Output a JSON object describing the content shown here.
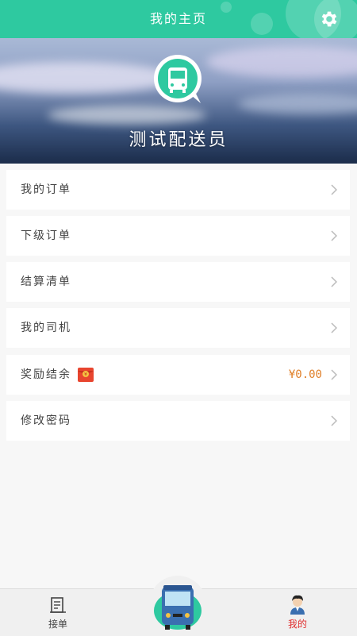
{
  "header": {
    "title": "我的主页",
    "settings_icon": "gear-icon"
  },
  "profile": {
    "name": "测试配送员",
    "logo_icon": "bus-chat-icon"
  },
  "menu": [
    {
      "label": "我的订单"
    },
    {
      "label": "下级订单"
    },
    {
      "label": "结算清单"
    },
    {
      "label": "我的司机"
    },
    {
      "label": "奖励结余",
      "amount": "¥0.00",
      "badge_icon": "red-envelope-icon"
    },
    {
      "label": "修改密码"
    }
  ],
  "bottom_nav": {
    "left": {
      "label": "接单",
      "icon": "receipt-icon"
    },
    "center": {
      "icon": "bus-icon"
    },
    "right": {
      "label": "我的",
      "icon": "user-avatar-icon",
      "active": true
    }
  },
  "colors": {
    "brand": "#2ec9a0",
    "amount": "#e0802a",
    "active_tab": "#e03030",
    "inactive_tab": "#444444"
  }
}
